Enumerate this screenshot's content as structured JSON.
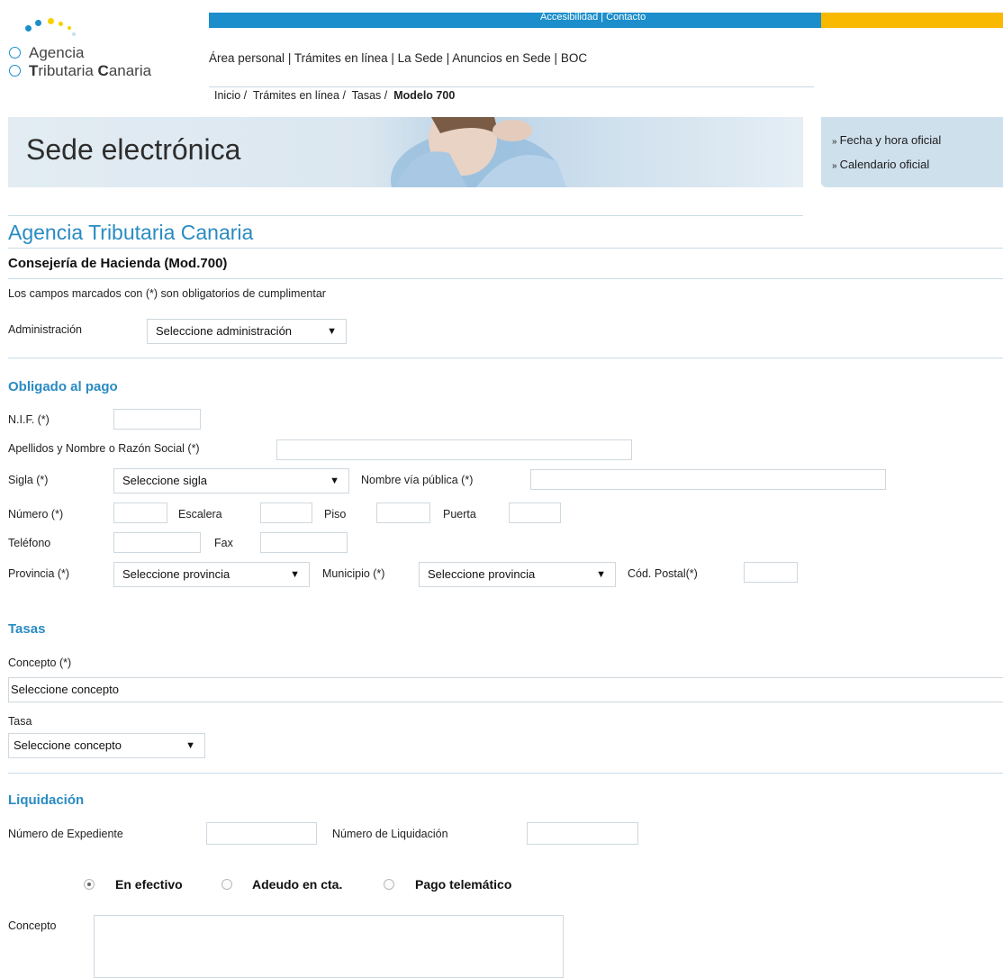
{
  "header": {
    "top_links": "Accesibilidad | Contacto",
    "logo": {
      "line1": "Agencia",
      "line2_a": "T",
      "line2_b": "ributaria ",
      "line2_c": "C",
      "line2_d": "anaria"
    },
    "nav": [
      "Área personal",
      "Trámites en línea",
      "La Sede",
      "Anuncios en Sede",
      "BOC"
    ],
    "breadcrumb": {
      "items": [
        "Inicio",
        "Trámites en línea",
        "Tasas"
      ],
      "current": "Modelo 700"
    },
    "banner_title": "Sede electrónica",
    "side_links": [
      "Fecha y hora oficial",
      "Calendario oficial"
    ]
  },
  "form": {
    "agency_title": "Agencia Tributaria Canaria",
    "subtitle": "Consejería de Hacienda (Mod.700)",
    "required_note": "Los campos marcados con (*) son obligatorios de cumplimentar",
    "administracion": {
      "label": "Administración",
      "value": "Seleccione administración"
    },
    "obligado": {
      "title": "Obligado al pago",
      "nif": "N.I.F. (*)",
      "nombre": "Apellidos y Nombre o Razón Social (*)",
      "sigla": {
        "label": "Sigla (*)",
        "value": "Seleccione sigla"
      },
      "via": "Nombre vía pública (*)",
      "numero": "Número (*)",
      "escalera": "Escalera",
      "piso": "Piso",
      "puerta": "Puerta",
      "telefono": "Teléfono",
      "fax": "Fax",
      "provincia": {
        "label": "Provincia (*)",
        "value": "Seleccione provincia"
      },
      "municipio": {
        "label": "Municipio (*)",
        "value": "Seleccione provincia"
      },
      "cp": "Cód. Postal(*)"
    },
    "tasas": {
      "title": "Tasas",
      "concepto": {
        "label": "Concepto (*)",
        "value": "Seleccione concepto"
      },
      "tasa": {
        "label": "Tasa",
        "value": "Seleccione concepto"
      }
    },
    "liquidacion": {
      "title": "Liquidación",
      "expediente": "Número de Expediente",
      "numero_liq": "Número de Liquidación",
      "payment_options": [
        "En efectivo",
        "Adeudo en cta.",
        "Pago telemático"
      ],
      "concepto": "Concepto"
    }
  },
  "colors": {
    "accent": "#1b8ecb",
    "heading": "#2a8bc2",
    "yellow": "#f8b900"
  }
}
